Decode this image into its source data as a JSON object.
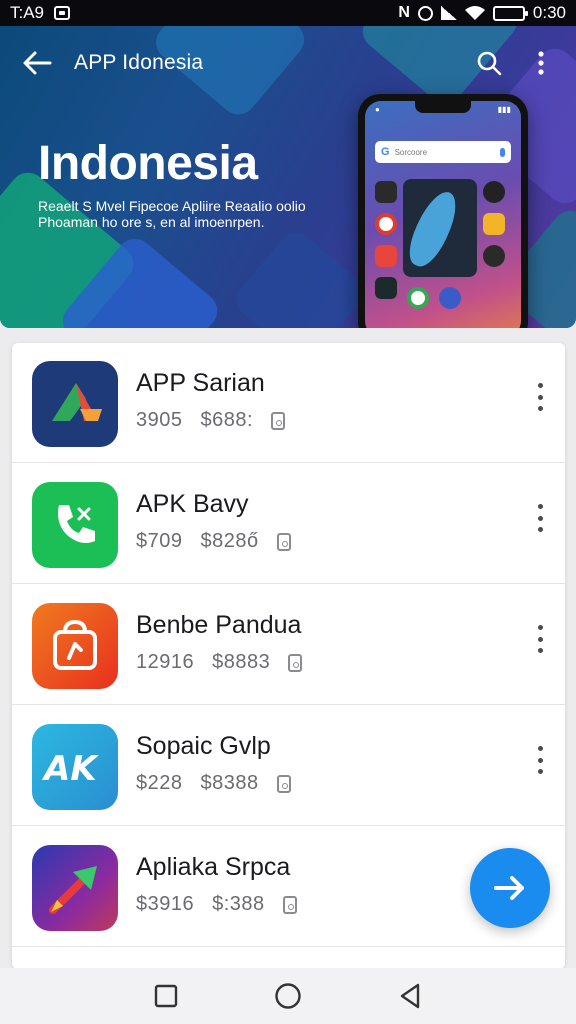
{
  "status_bar": {
    "time": "T:A9",
    "clock": "0:30",
    "battery_level": 0.85
  },
  "header": {
    "title": "APP Idonesia"
  },
  "hero": {
    "title": "Indonesia",
    "subtitle": "Reaelt S Mvel Fipecoe Apliire Reaalio oolio Phoaman ho ore s, en al imoenrpen.",
    "phone_search_placeholder": "Sorcoore"
  },
  "apps": [
    {
      "name": "APP Sarian",
      "downloads": "3905",
      "size": "$688:",
      "icon": "arrow-a-logo-icon",
      "color": "#1e3a78"
    },
    {
      "name": "APK Bavy",
      "downloads": "$709",
      "size": "$828ő",
      "icon": "phone-icon",
      "color": "#1cbf55"
    },
    {
      "name": "Benbe Pandua",
      "downloads": "12916",
      "size": "$8883",
      "icon": "shopping-bag-icon",
      "color": "#f0551f"
    },
    {
      "name": "Sopaic Gvlp",
      "downloads": "$228",
      "size": "$8388",
      "icon": "ak-logo-icon",
      "color": "#2aa0d8"
    },
    {
      "name": "Apliaka Srpca",
      "downloads": "$3916",
      "size": "$:388",
      "icon": "rocket-arrow-icon",
      "color": "#6a2fa8"
    }
  ],
  "colors": {
    "accent": "#1a8cf0",
    "status_bar": "#0a0a0e"
  }
}
